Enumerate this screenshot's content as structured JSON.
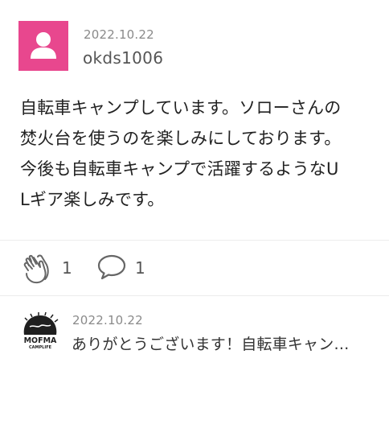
{
  "post": {
    "date": "2022.10.22",
    "username": "okds1006",
    "body": "自転車キャンプしています。ソローさんの\n焚火台を使うのを楽しみにしております。\n今後も自転車キャンプで活躍するようなU\nLギア楽しみです。",
    "avatar_icon": "user-silhouette-icon",
    "avatar_color": "#e8478e"
  },
  "actions": {
    "clap_icon": "clap-hands-icon",
    "clap_count": "1",
    "comment_icon": "speech-bubble-icon",
    "comment_count": "1"
  },
  "reply": {
    "date": "2022.10.22",
    "text": "ありがとうございます！自転車キャン…",
    "avatar_logo_text": "MOFMA",
    "avatar_logo_subtext": "CAMPLIFE"
  }
}
